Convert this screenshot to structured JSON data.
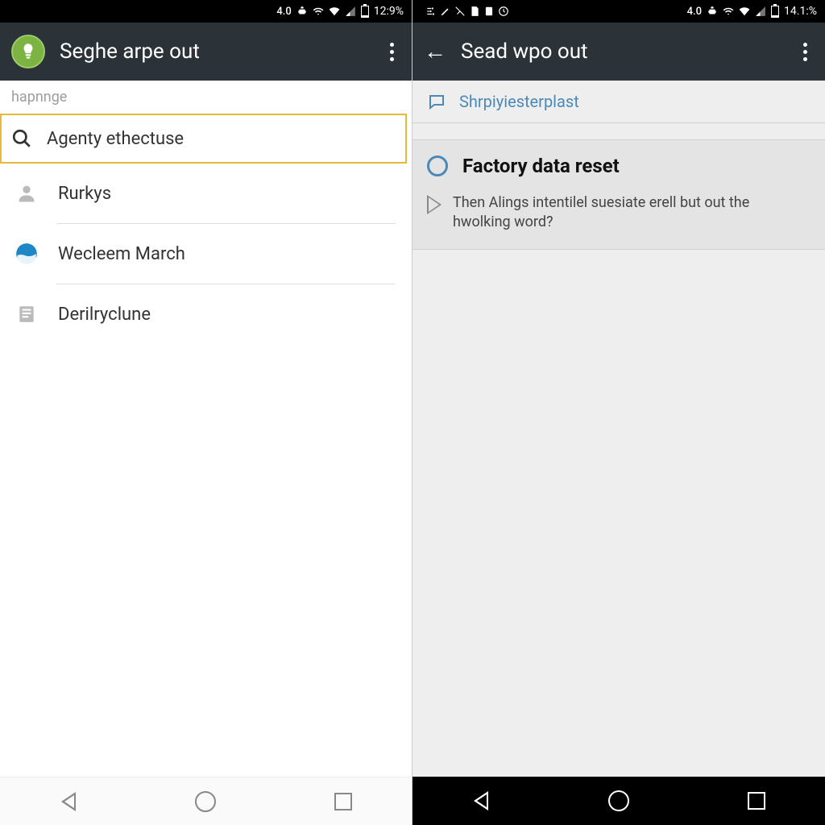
{
  "left": {
    "status": {
      "net": "4.0",
      "battery": "12:9%"
    },
    "appbar": {
      "title": "Seghe arpe out"
    },
    "section_label": "hapnnge",
    "search": {
      "text": "Agenty ethectuse"
    },
    "items": [
      {
        "label": "Rurkys"
      },
      {
        "label": "Wecleem March"
      },
      {
        "label": "Derilryclune"
      }
    ]
  },
  "right": {
    "status": {
      "net": "4.0",
      "battery": "14.1:%"
    },
    "appbar": {
      "title": "Sead wpo out"
    },
    "help_text": "Shrpiyiesterplast",
    "section": {
      "title": "Factory data reset",
      "desc": "Then Alings intentilel suesiate erell but out the hwolking word?"
    }
  }
}
